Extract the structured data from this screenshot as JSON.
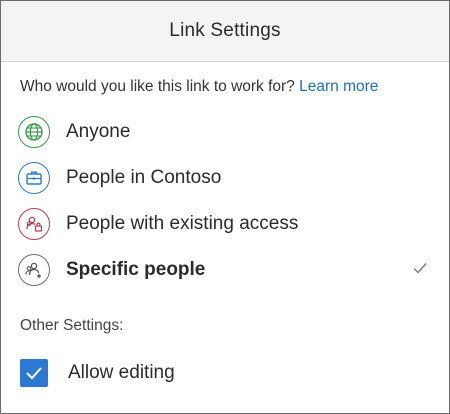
{
  "header": {
    "title": "Link Settings"
  },
  "prompt": {
    "question": "Who would you like this link to work for?",
    "learn_more": "Learn more"
  },
  "options": [
    {
      "label": "Anyone",
      "icon": "globe-icon",
      "color": "#3a9a4b",
      "selected": false
    },
    {
      "label": "People in Contoso",
      "icon": "briefcase-icon",
      "color": "#2f79c4",
      "selected": false
    },
    {
      "label": "People with existing access",
      "icon": "people-lock-icon",
      "color": "#c0394b",
      "selected": false
    },
    {
      "label": "Specific people",
      "icon": "people-add-icon",
      "color": "#6b6b6b",
      "selected": true
    }
  ],
  "other_settings": {
    "heading": "Other Settings:",
    "allow_editing": {
      "label": "Allow editing",
      "checked": true,
      "color": "#2b79d0"
    }
  }
}
